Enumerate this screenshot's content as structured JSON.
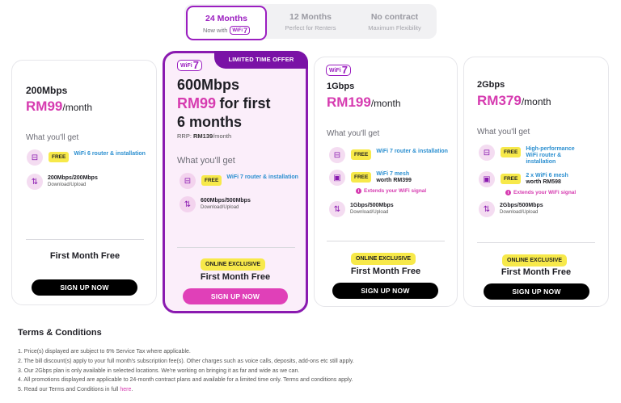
{
  "tabs": [
    {
      "title": "24 Months",
      "subtitle": "Now with",
      "badge": "WiFi7",
      "active": true
    },
    {
      "title": "12 Months",
      "subtitle": "Perfect for Renters"
    },
    {
      "title": "No contract",
      "subtitle": "Maximum Flexibility"
    }
  ],
  "wifi7_logo": {
    "text": "WiFi",
    "num": "7"
  },
  "plans": [
    {
      "speed": "200Mbps",
      "price": "RM99",
      "per": "/month",
      "what_you_get": "What you'll get",
      "free": "FREE",
      "feature1": "WiFi 6 router & installation",
      "speed_feature": "200Mbps/200Mbps",
      "speed_sub": "Download/Upload",
      "offer": "First Month Free",
      "cta": "SIGN UP NOW"
    },
    {
      "ribbon": "LIMITED TIME OFFER",
      "speed": "600Mbps",
      "price": "RM99",
      "price_suffix": "for first",
      "price_line2": "6 months",
      "rrp_label": "RRP:",
      "rrp_value": "RM139",
      "rrp_per": "/month",
      "what_you_get": "What you'll get",
      "free": "FREE",
      "feature1": "WiFi 7 router & installation",
      "speed_feature": "600Mbps/500Mbps",
      "speed_sub": "Download/Upload",
      "badge": "ONLINE EXCLUSIVE",
      "offer": "First Month Free",
      "cta": "SIGN UP NOW"
    },
    {
      "speed": "1Gbps",
      "price": "RM199",
      "per": "/month",
      "what_you_get": "What you'll get",
      "free": "FREE",
      "feature1": "WiFi 7 router & installation",
      "feature2": "WiFi 7 mesh",
      "feature2_worth": "worth RM399",
      "extends": "Extends your WiFi signal",
      "speed_feature": "1Gbps/500Mbps",
      "speed_sub": "Download/Upload",
      "badge": "ONLINE EXCLUSIVE",
      "offer": "First Month Free",
      "cta": "SIGN UP NOW"
    },
    {
      "speed": "2Gbps",
      "price": "RM379",
      "per": "/month",
      "what_you_get": "What you'll get",
      "free": "FREE",
      "feature1": "High-performance WiFi router & installation",
      "feature2": "2 x WiFi 6 mesh",
      "feature2_worth": "worth RM598",
      "extends": "Extends your WiFi signal",
      "speed_feature": "2Gbps/500Mbps",
      "speed_sub": "Download/Upload",
      "badge": "ONLINE EXCLUSIVE",
      "offer": "First Month Free",
      "cta": "SIGN UP NOW"
    }
  ],
  "terms": {
    "title": "Terms & Conditions",
    "items": [
      "1. Price(s) displayed are subject to 6% Service Tax where applicable.",
      "2. The bill discount(s) apply to your full month's subscription fee(s). Other charges such as voice calls, deposits, add-ons etc still apply.",
      "3. Our 2Gbps plan is only available in selected locations. We're working on bringing it as far and wide as we can.",
      "4. All promotions displayed are applicable to 24-month contract plans and available for a limited time only. Terms and conditions apply.",
      "5. Read our Terms and Conditions in full"
    ],
    "link": "here",
    "link_end": "."
  },
  "colors": {
    "accent": "#9b1ec0",
    "price": "#d63bb0",
    "free": "#f7e94a",
    "cta_featured": "#e040b8"
  }
}
